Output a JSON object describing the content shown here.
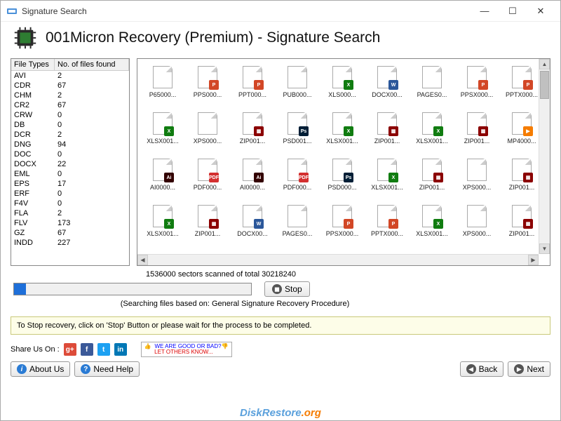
{
  "window": {
    "title": "Signature Search"
  },
  "header": {
    "app_title": "001Micron Recovery (Premium) - Signature Search"
  },
  "file_types": {
    "col1": "File Types",
    "col2": "No. of files found",
    "rows": [
      {
        "t": "AVI",
        "n": "2"
      },
      {
        "t": "CDR",
        "n": "67"
      },
      {
        "t": "CHM",
        "n": "2"
      },
      {
        "t": "CR2",
        "n": "67"
      },
      {
        "t": "CRW",
        "n": "0"
      },
      {
        "t": "DB",
        "n": "0"
      },
      {
        "t": "DCR",
        "n": "2"
      },
      {
        "t": "DNG",
        "n": "94"
      },
      {
        "t": "DOC",
        "n": "0"
      },
      {
        "t": "DOCX",
        "n": "22"
      },
      {
        "t": "EML",
        "n": "0"
      },
      {
        "t": "EPS",
        "n": "17"
      },
      {
        "t": "ERF",
        "n": "0"
      },
      {
        "t": "F4V",
        "n": "0"
      },
      {
        "t": "FLA",
        "n": "2"
      },
      {
        "t": "FLV",
        "n": "173"
      },
      {
        "t": "GZ",
        "n": "67"
      },
      {
        "t": "INDD",
        "n": "227"
      }
    ]
  },
  "files": [
    {
      "name": "P65000...",
      "b": ""
    },
    {
      "name": "PPS000...",
      "b": "ppt"
    },
    {
      "name": "PPT000...",
      "b": "ppt"
    },
    {
      "name": "PUB000...",
      "b": ""
    },
    {
      "name": "XLS000...",
      "b": "xls"
    },
    {
      "name": "DOCX00...",
      "b": "doc"
    },
    {
      "name": "PAGES0...",
      "b": ""
    },
    {
      "name": "PPSX000...",
      "b": "ppt"
    },
    {
      "name": "PPTX000...",
      "b": "ppt"
    },
    {
      "name": "XLSX001...",
      "b": "xls"
    },
    {
      "name": "XPS000...",
      "b": ""
    },
    {
      "name": "ZIP001...",
      "b": "zip"
    },
    {
      "name": "PSD001...",
      "b": "ps"
    },
    {
      "name": "XLSX001...",
      "b": "xls"
    },
    {
      "name": "ZIP001...",
      "b": "zip"
    },
    {
      "name": "XLSX001...",
      "b": "xls"
    },
    {
      "name": "ZIP001...",
      "b": "zip"
    },
    {
      "name": "MP4000...",
      "b": "mp"
    },
    {
      "name": "AI0000...",
      "b": "ai"
    },
    {
      "name": "PDF000...",
      "b": "pdf"
    },
    {
      "name": "AI0000...",
      "b": "ai"
    },
    {
      "name": "PDF000...",
      "b": "pdf"
    },
    {
      "name": "PSD000...",
      "b": "ps"
    },
    {
      "name": "XLSX001...",
      "b": "xls"
    },
    {
      "name": "ZIP001...",
      "b": "zip"
    },
    {
      "name": "XPS000...",
      "b": ""
    },
    {
      "name": "ZIP001...",
      "b": "zip"
    },
    {
      "name": "XLSX001...",
      "b": "xls"
    },
    {
      "name": "ZIP001...",
      "b": "zip"
    },
    {
      "name": "DOCX00...",
      "b": "doc"
    },
    {
      "name": "PAGES0...",
      "b": ""
    },
    {
      "name": "PPSX000...",
      "b": "ppt"
    },
    {
      "name": "PPTX000...",
      "b": "ppt"
    },
    {
      "name": "XLSX001...",
      "b": "xls"
    },
    {
      "name": "XPS000...",
      "b": ""
    },
    {
      "name": "ZIP001...",
      "b": "zip"
    }
  ],
  "progress": {
    "status": "1536000 sectors scanned of total 30218240",
    "mode": "(Searching files based on:  General Signature Recovery Procedure)",
    "stop_label": "Stop"
  },
  "hint": "To Stop recovery, click on 'Stop' Button or please wait for the process to be completed.",
  "share": {
    "label": "Share Us On :",
    "feedback_l1": "WE ARE GOOD OR BAD?",
    "feedback_l2": "LET OTHERS KNOW..."
  },
  "buttons": {
    "about": "About Us",
    "help": "Need Help",
    "back": "Back",
    "next": "Next"
  },
  "watermark": {
    "t1": "DiskRestore",
    "t2": ".org"
  }
}
